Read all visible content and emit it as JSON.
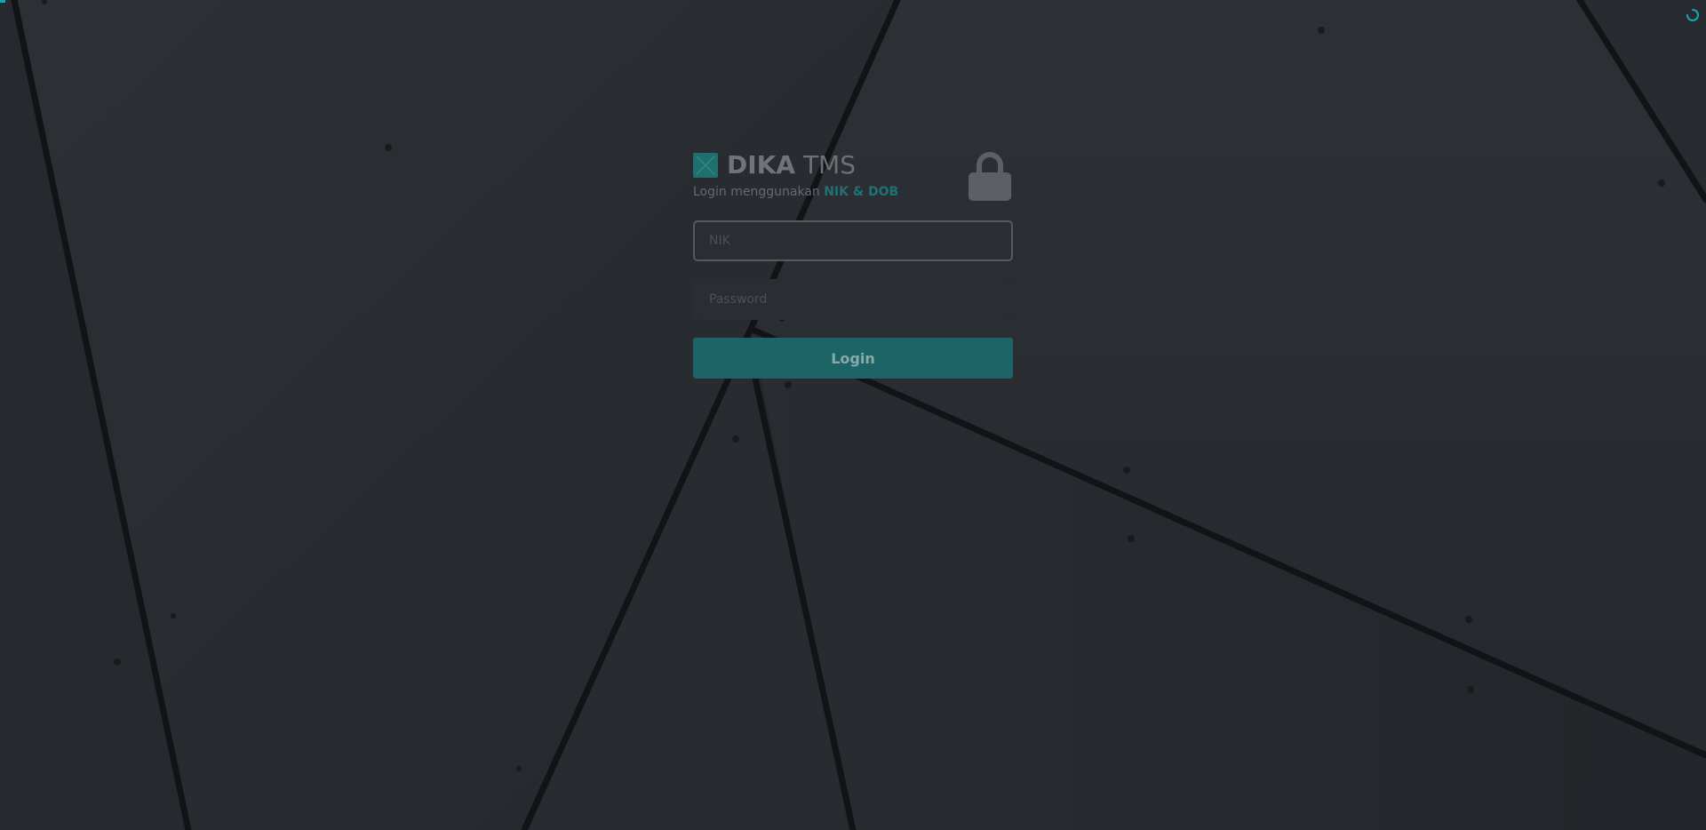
{
  "brand": {
    "name_bold": "DIKA",
    "name_light": "TMS",
    "subtitle_prefix": "Login menggunakan ",
    "subtitle_accent": "NIK & DOB",
    "logo_icon": "dika-logo-icon",
    "accent_color": "#1f7274"
  },
  "form": {
    "nik_placeholder": "NIK",
    "password_placeholder": "Password",
    "login_label": "Login"
  },
  "icons": {
    "lock": "lock-icon",
    "loader": "loading-spinner-icon"
  }
}
